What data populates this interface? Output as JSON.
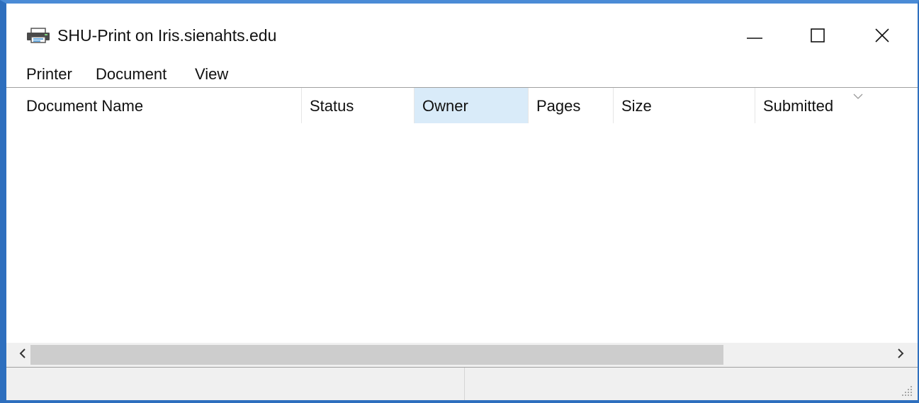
{
  "window": {
    "title": "SHU-Print on Iris.sienahts.edu",
    "icon": "printer-icon",
    "controls": {
      "minimize_icon": "minimize-icon",
      "maximize_icon": "maximize-icon",
      "close_icon": "close-icon"
    },
    "accent_color": "#2e6fbe"
  },
  "menu": {
    "items": [
      {
        "label": "Printer"
      },
      {
        "label": "Document"
      },
      {
        "label": "View"
      }
    ]
  },
  "list": {
    "columns": [
      {
        "label": "Document Name"
      },
      {
        "label": "Status"
      },
      {
        "label": "Owner",
        "hovered": true
      },
      {
        "label": "Pages"
      },
      {
        "label": "Size"
      },
      {
        "label": "Submitted"
      }
    ],
    "rows": [],
    "hover_color": "#d9ebf9"
  },
  "scrollbar": {
    "left_icon": "chevron-left-icon",
    "right_icon": "chevron-right-icon"
  },
  "statusbar": {
    "panes": [
      "",
      ""
    ]
  }
}
